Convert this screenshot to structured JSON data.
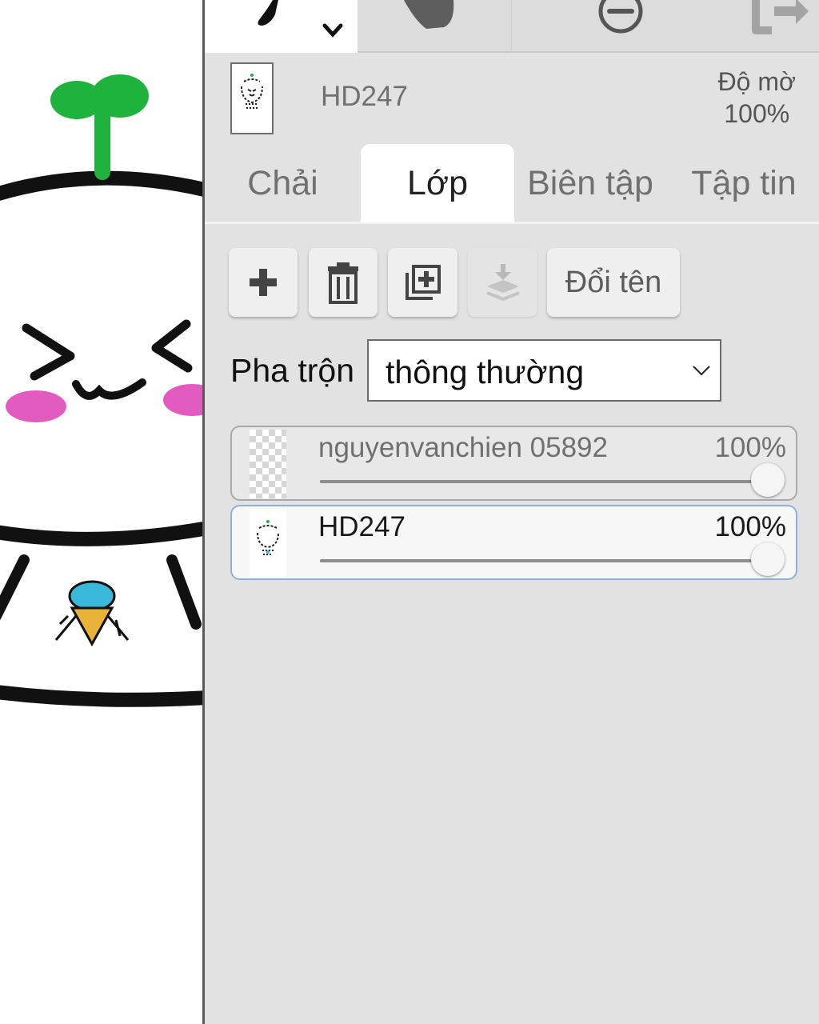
{
  "current_layer": {
    "name": "HD247",
    "opacity_label": "Độ mờ",
    "opacity_value": "100%"
  },
  "tabs": [
    {
      "label": "Chải",
      "active": false
    },
    {
      "label": "Lớp",
      "active": true
    },
    {
      "label": "Biên tập",
      "active": false
    },
    {
      "label": "Tập tin",
      "active": false
    }
  ],
  "layer_actions": {
    "rename_label": "Đổi tên"
  },
  "blend": {
    "label": "Pha trộn",
    "value": "thông thường"
  },
  "layers": [
    {
      "name": "nguyenvanchien 05892",
      "opacity_text": "100%",
      "opacity": 1.0,
      "selected": false
    },
    {
      "name": "HD247",
      "opacity_text": "100%",
      "opacity": 1.0,
      "selected": true
    }
  ],
  "colors": {
    "panel_bg": "#e2e2e2",
    "selected_border": "#8fb0df",
    "sprout_green": "#1fb33e",
    "blush_pink": "#e25bbf",
    "icecream_blue": "#39b8d9",
    "cone_yellow": "#e8b338"
  },
  "icons": {
    "toolbar": [
      "brush-icon",
      "chevron-down-icon",
      "smudge-hand-icon",
      "zoom-out-icon",
      "redo-icon"
    ],
    "actions": [
      "plus-icon",
      "trash-icon",
      "duplicate-icon",
      "merge-down-icon"
    ]
  }
}
